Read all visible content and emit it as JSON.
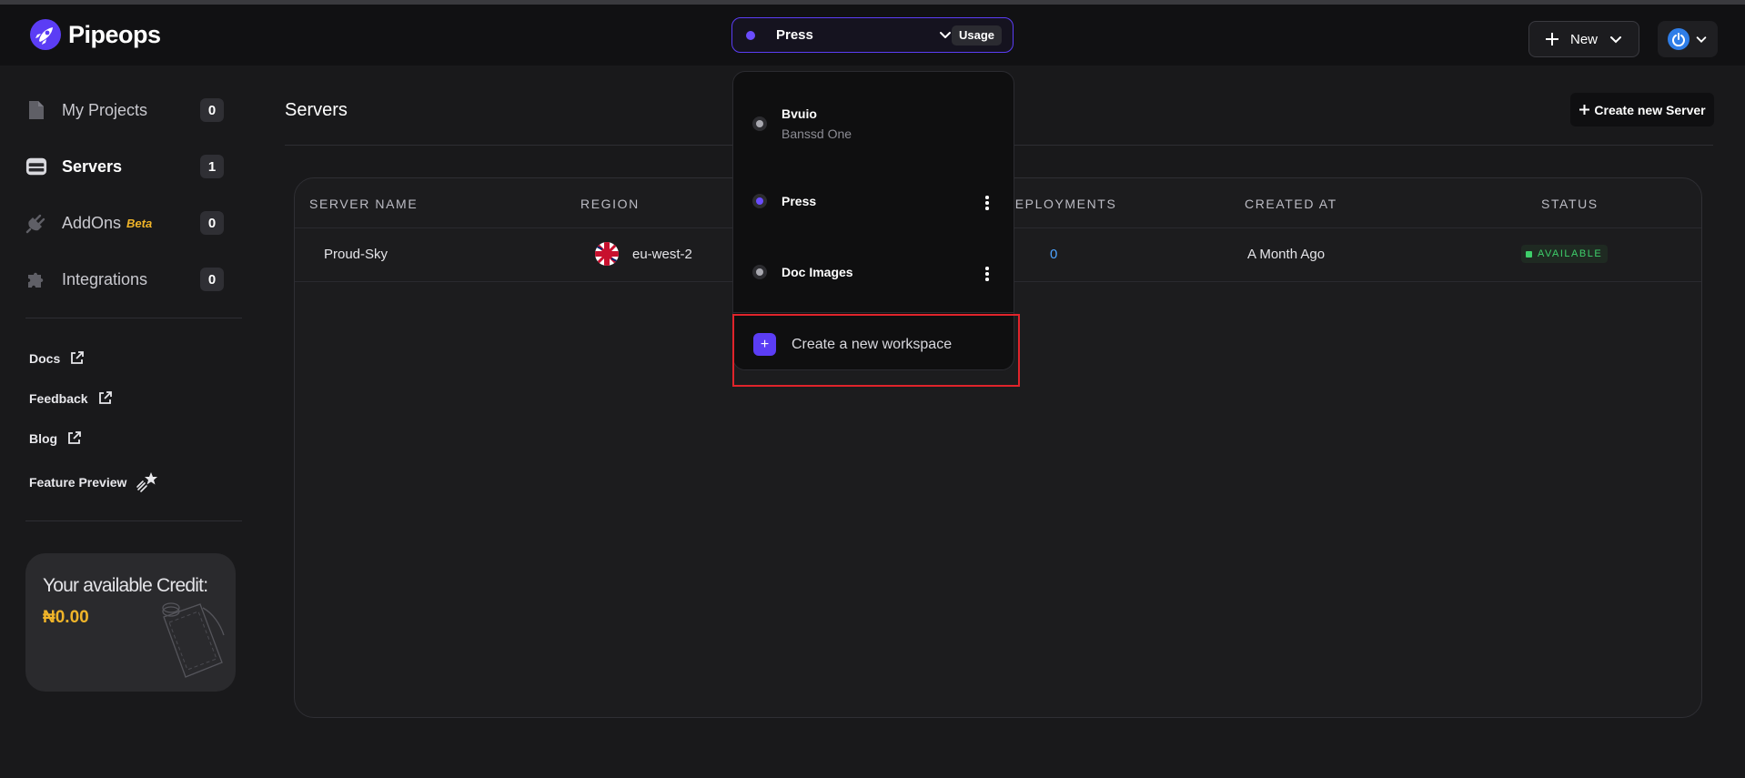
{
  "header": {
    "logo_text": "Pipeops",
    "workspace": {
      "name": "Press",
      "usage_label": "Usage"
    },
    "new_button_label": "New"
  },
  "sidebar": {
    "nav": [
      {
        "label": "My Projects",
        "count": "0",
        "icon": "document-icon"
      },
      {
        "label": "Servers",
        "count": "1",
        "icon": "server-icon"
      },
      {
        "label": "AddOns",
        "badge": "Beta",
        "count": "0",
        "icon": "plug-icon"
      },
      {
        "label": "Integrations",
        "count": "0",
        "icon": "puzzle-icon"
      }
    ],
    "links": [
      {
        "label": "Docs",
        "icon": "external-link-icon"
      },
      {
        "label": "Feedback",
        "icon": "external-link-icon"
      },
      {
        "label": "Blog",
        "icon": "external-link-icon"
      },
      {
        "label": "Feature Preview",
        "icon": "shooting-star-icon"
      }
    ],
    "credit": {
      "title": "Your available Credit:",
      "amount": "₦0.00"
    }
  },
  "main": {
    "title": "Servers",
    "create_button_label": "Create new Server",
    "table": {
      "columns": [
        "SERVER NAME",
        "REGION",
        "DEPLOYMENTS",
        "CREATED AT",
        "STATUS"
      ],
      "rows": [
        {
          "server_name": "Proud-Sky",
          "region": "eu-west-2",
          "deployments": "0",
          "created_at": "A Month Ago",
          "status": "AVAILABLE"
        }
      ]
    }
  },
  "workspace_dropdown": {
    "items": [
      {
        "name": "Bvuio",
        "subtitle": "Banssd One",
        "active": false
      },
      {
        "name": "Press",
        "active": true
      },
      {
        "name": "Doc Images",
        "active": false
      }
    ],
    "create_label": "Create a new workspace"
  },
  "colors": {
    "accent": "#5b3df5",
    "credit": "#f0b429",
    "status_available": "#3ecf6a",
    "highlight": "#e0242b"
  }
}
